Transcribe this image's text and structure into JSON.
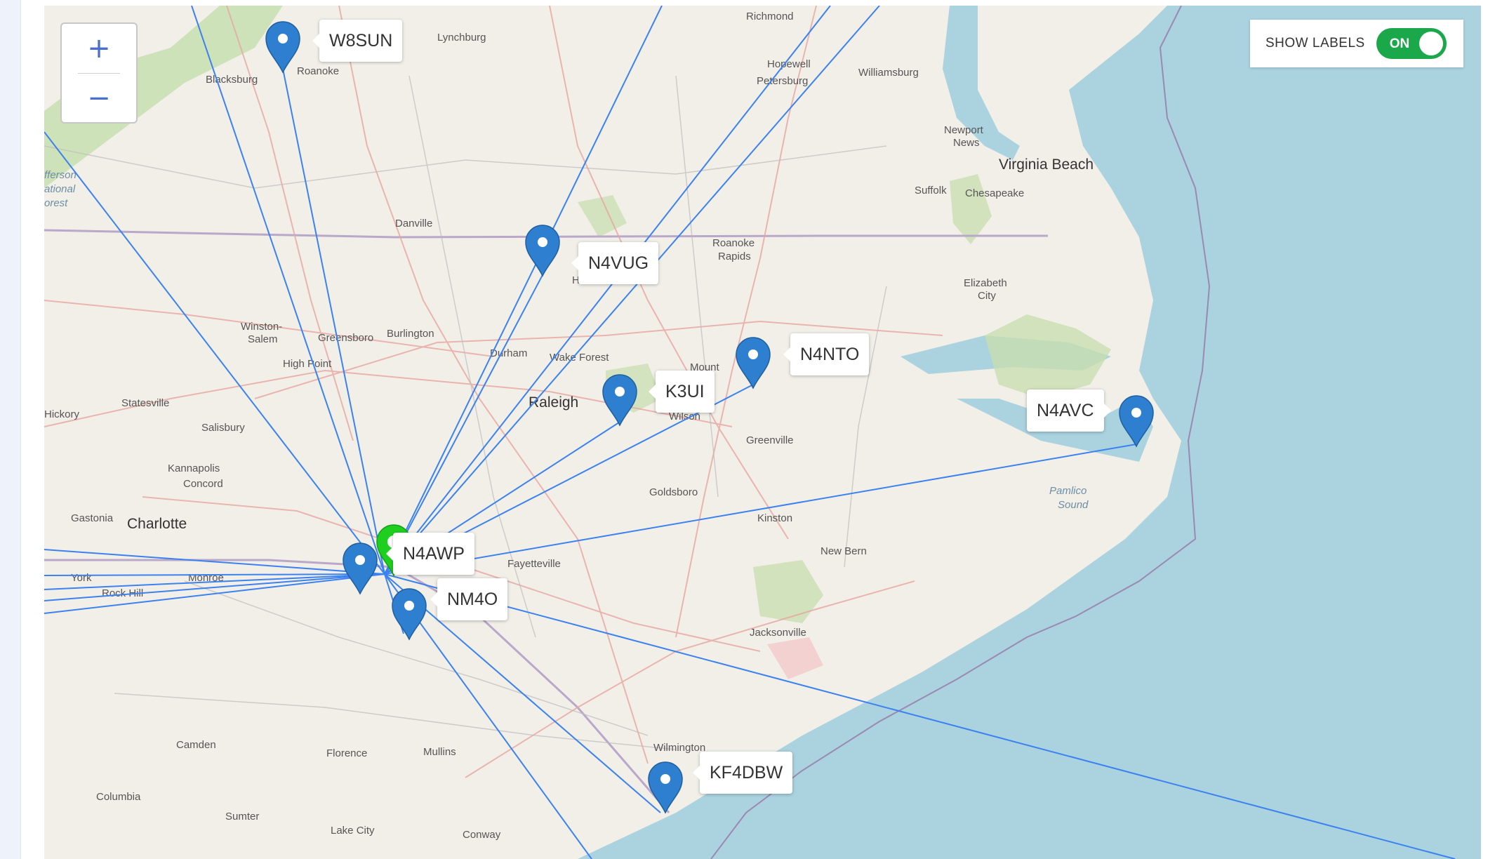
{
  "map": {
    "controls": {
      "zoom_in": "+",
      "zoom_out": "−"
    },
    "show_labels": {
      "label": "SHOW LABELS",
      "state": "ON"
    },
    "home_station": {
      "callsign": "N4AWP",
      "color": "#1fcf1f"
    },
    "stations": [
      {
        "id": "w8sun",
        "callsign": "W8SUN"
      },
      {
        "id": "n4vug",
        "callsign": "N4VUG"
      },
      {
        "id": "n4nto",
        "callsign": "N4NTO"
      },
      {
        "id": "k3ui",
        "callsign": "K3UI"
      },
      {
        "id": "n4avc",
        "callsign": "N4AVC"
      },
      {
        "id": "nm4o",
        "callsign": "NM4O"
      },
      {
        "id": "kf4dbw",
        "callsign": "KF4DBW"
      }
    ],
    "places": {
      "richmond": "Richmond",
      "lynchburg": "Lynchburg",
      "roanoke": "Roanoke",
      "blacksburg": "Blacksburg",
      "hopewell": "Hopewell",
      "petersburg": "Petersburg",
      "williamsburg": "Williamsburg",
      "newport_news_1": "Newport",
      "newport_news_2": "News",
      "virginia_beach": "Virginia Beach",
      "suffolk": "Suffolk",
      "chesapeake": "Chesapeake",
      "danville": "Danville",
      "roanoke_rapids_1": "Roanoke",
      "roanoke_rapids_2": "Rapids",
      "henderson": "Henderson",
      "elizabeth_city_1": "Elizabeth",
      "elizabeth_city_2": "City",
      "winston_salem_1": "Winston-",
      "winston_salem_2": "Salem",
      "greensboro": "Greensboro",
      "burlington": "Burlington",
      "durham": "Durham",
      "wake_forest": "Wake Forest",
      "raleigh": "Raleigh",
      "rocky_mount": "Mount",
      "wilson": "Wilson",
      "high_point": "High Point",
      "statesville": "Statesville",
      "hickory": "Hickory",
      "salisbury": "Salisbury",
      "greenville": "Greenville",
      "kannapolis": "Kannapolis",
      "concord": "Concord",
      "goldsboro": "Goldsboro",
      "gastonia": "Gastonia",
      "charlotte": "Charlotte",
      "kinston": "Kinston",
      "pamlico_1": "Pamlico",
      "pamlico_2": "Sound",
      "fayetteville": "Fayetteville",
      "new_bern": "New Bern",
      "york": "York",
      "monroe": "Monroe",
      "rock_hill": "Rock Hill",
      "jacksonville": "Jacksonville",
      "camden": "Camden",
      "florence": "Florence",
      "mullins": "Mullins",
      "wilmington": "Wilmington",
      "columbia": "Columbia",
      "sumter": "Sumter",
      "lake_city": "Lake City",
      "conway": "Conway",
      "jefferson_1": "fferson",
      "jefferson_2": "ational",
      "jefferson_3": "orest"
    }
  }
}
